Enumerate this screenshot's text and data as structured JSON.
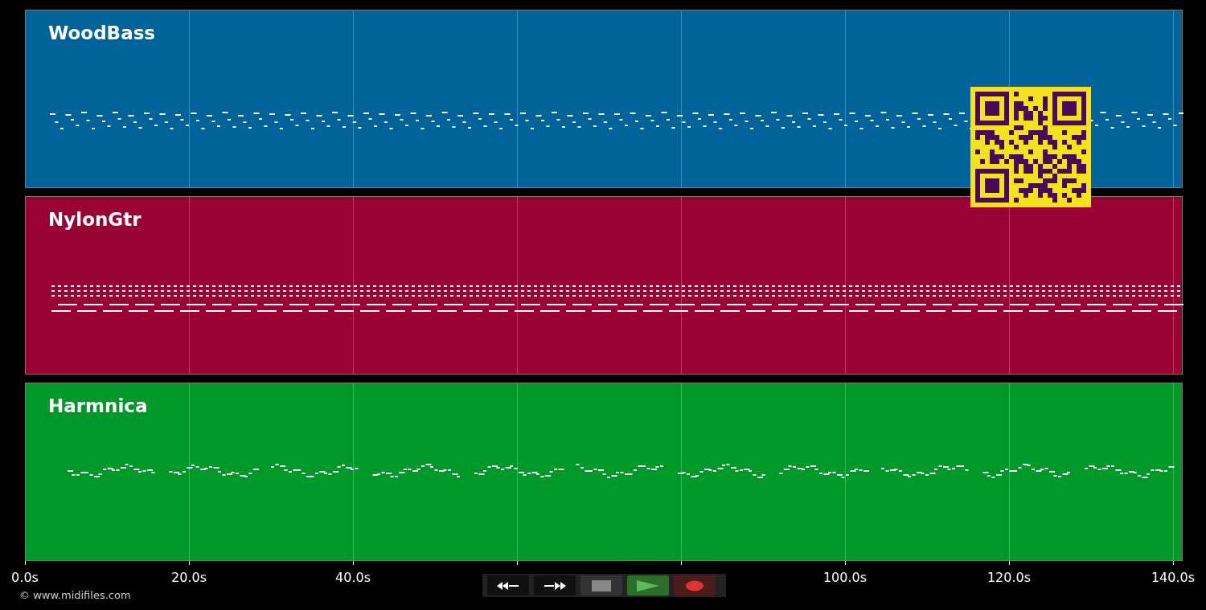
{
  "tracks": [
    {
      "name": "WoodBass",
      "color": "#00649a"
    },
    {
      "name": "NylonGtr",
      "color": "#990033"
    },
    {
      "name": "Harmnica",
      "color": "#009929"
    }
  ],
  "axis_ticks": [
    {
      "label": "0.0s"
    },
    {
      "label": "20.0s"
    },
    {
      "label": "40.0s"
    },
    {
      "covered": true
    },
    {
      "covered": true
    },
    {
      "label": "100.0s"
    },
    {
      "label": "120.0s"
    },
    {
      "label": "140.0s"
    }
  ],
  "transport": [
    {
      "kind": "rewind"
    },
    {
      "kind": "forward"
    },
    {
      "kind": "stop"
    },
    {
      "kind": "play"
    },
    {
      "kind": "record"
    }
  ],
  "footer": {
    "copyright": "© www.midifiles.com"
  }
}
